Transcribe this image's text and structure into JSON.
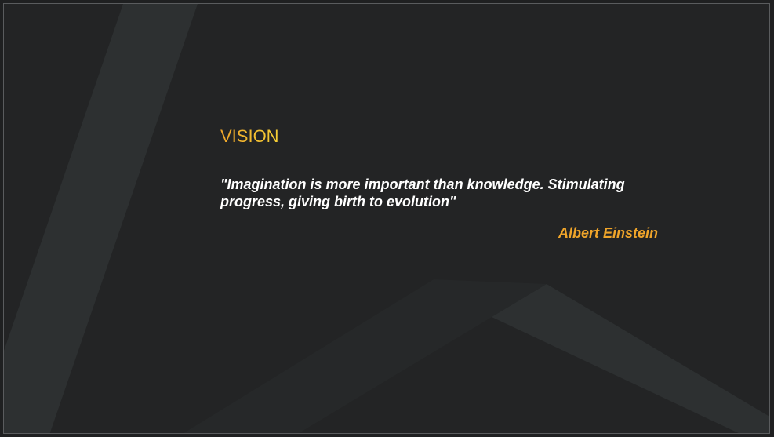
{
  "slide": {
    "title": "VISION",
    "quote": "\"Imagination is more important than knowledge. Stimulating progress, giving birth to evolution\"",
    "author": "Albert Einstein"
  },
  "colors": {
    "background": "#232425",
    "decor_band": "#2d3031",
    "decor_band_dark": "#262829",
    "title_gradient_start": "#f0a52a",
    "title_gradient_end": "#f5cf35",
    "quote_text": "#ffffff",
    "author_text": "#f0a52a"
  }
}
